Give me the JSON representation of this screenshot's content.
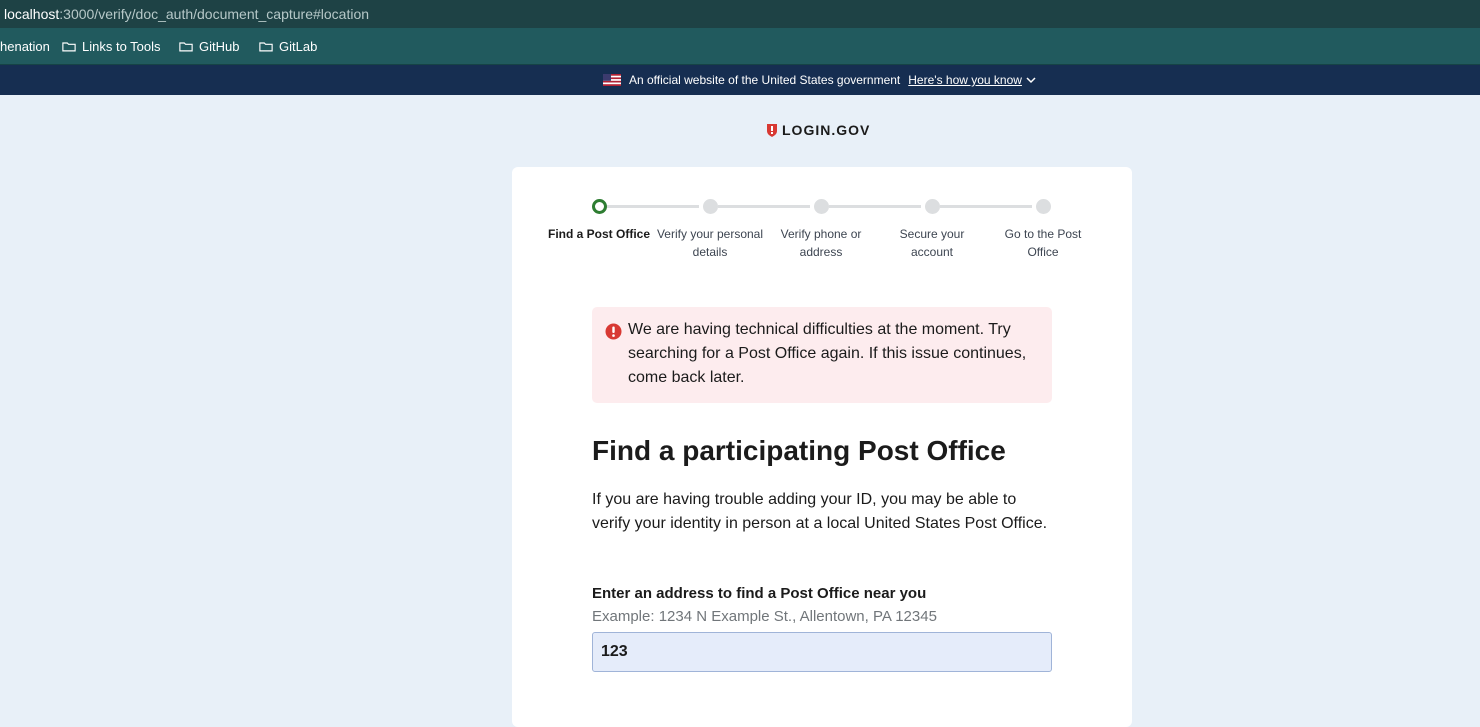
{
  "browser": {
    "url_host": "localhost",
    "url_path": ":3000/verify/doc_auth/document_capture#location",
    "bookmarks": [
      "henation",
      "Links to Tools",
      "GitHub",
      "GitLab"
    ]
  },
  "gov_banner": {
    "text": "An official website of the United States government",
    "link": "Here's how you know"
  },
  "logo": {
    "text": "LOGIN.GOV"
  },
  "steps": [
    {
      "label": "Find a Post Office",
      "state": "current"
    },
    {
      "label": "Verify your personal details",
      "state": "upcoming"
    },
    {
      "label": "Verify phone or address",
      "state": "upcoming"
    },
    {
      "label": "Secure your account",
      "state": "upcoming"
    },
    {
      "label": "Go to the Post Office",
      "state": "upcoming"
    }
  ],
  "alert": {
    "message": "We are having technical difficulties at the moment. Try searching for a Post Office again. If this issue continues, come back later."
  },
  "page": {
    "title": "Find a participating Post Office",
    "intro": "If you are having trouble adding your ID, you may be able to verify your identity in person at a local United States Post Office.",
    "address_label": "Enter an address to find a Post Office near you",
    "address_hint": "Example: 1234 N Example St., Allentown, PA 12345",
    "address_value": "123"
  },
  "colors": {
    "browser_bar": "#1e4245",
    "bookmarks_bar": "#215a5e",
    "gov_banner": "#162e51",
    "page_bg": "#e8f0f8",
    "alert_bg": "#fdecee",
    "error_red": "#d83933",
    "step_current": "#2e7d32"
  }
}
